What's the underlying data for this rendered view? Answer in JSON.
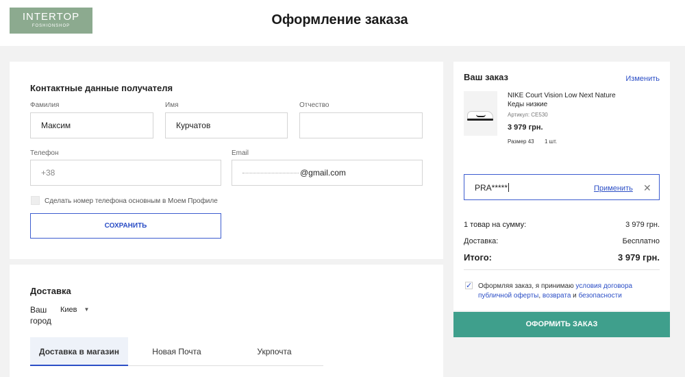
{
  "header": {
    "logo_line1": "INTERTOP",
    "logo_line2": "FOSHIONSHOP",
    "title": "Оформление заказа"
  },
  "contacts": {
    "title": "Контактные данные получателя",
    "last_name_label": "Фамилия",
    "last_name_value": "Максим",
    "first_name_label": "Имя",
    "first_name_value": "Курчатов",
    "middle_name_label": "Отчество",
    "middle_name_value": "",
    "phone_label": "Телефон",
    "phone_placeholder": "+38",
    "email_label": "Email",
    "email_value": "@gmail.com",
    "make_primary_label": "Сделать номер телефона основным в Моем Профиле",
    "save_button": "СОХРАНИТЬ"
  },
  "delivery": {
    "title": "Доставка",
    "city_label_line1": "Ваш",
    "city_label_line2": "город",
    "city_value": "Киев",
    "tabs": [
      "Доставка в магазин",
      "Новая Почта",
      "Укрпочта"
    ]
  },
  "order": {
    "title": "Ваш заказ",
    "edit_link": "Изменить",
    "product": {
      "name_line1": "NIKE Court Vision Low Next Nature",
      "name_line2": "Кеды низкие",
      "sku": "Артикул: CE530",
      "price": "3 979 грн.",
      "size": "Размер 43",
      "qty": "1 шт."
    },
    "promo_value": "PRA*****",
    "apply_link": "Применить",
    "summary_label": "1 товар на сумму:",
    "summary_value": "3 979 грн.",
    "delivery_label": "Доставка:",
    "delivery_value": "Бесплатно",
    "total_label": "Итого:",
    "total_value": "3 979 грн.",
    "agree_text_1": "Оформляя заказ, я принимаю ",
    "agree_link_1": "условия договора публичной оферты",
    "agree_text_2": ", ",
    "agree_link_2": "возврата",
    "agree_text_3": " и ",
    "agree_link_3": "безопасности",
    "agree_checked": true
  },
  "checkout_button": "ОФОРМИТЬ ЗАКАЗ",
  "colors": {
    "accent_blue": "#2b4ec6",
    "checkout_green": "#3f9f8c",
    "logo_green": "#8caa8f"
  }
}
